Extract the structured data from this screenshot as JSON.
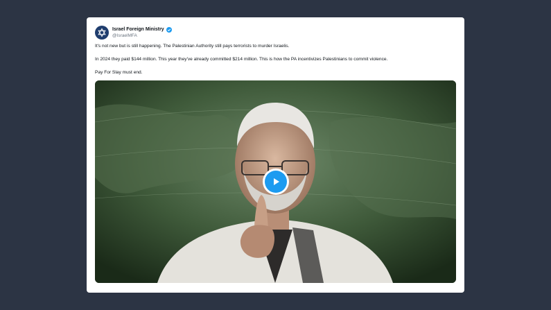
{
  "tweet": {
    "author": {
      "display_name": "Israel Foreign Ministry",
      "handle": "@IsraelMFA",
      "verified": true,
      "avatar_icon": "star-of-david-emblem-icon"
    },
    "paragraphs": [
      "It's not new but is still happening. The Palestinian Authority still pays terrorists to murder Israelis.",
      "In 2024 they paid $144 million. This year they've already committed $214 million. This is how the PA incentivizes Palestinians to commit violence.",
      "Pay For Slay must end."
    ],
    "media": {
      "type": "video",
      "play_icon": "play-icon"
    }
  },
  "colors": {
    "page_background": "#2c3444",
    "card_background": "#ffffff",
    "verified_blue": "#1d9bf0",
    "play_button_blue": "#1d9bf0"
  }
}
